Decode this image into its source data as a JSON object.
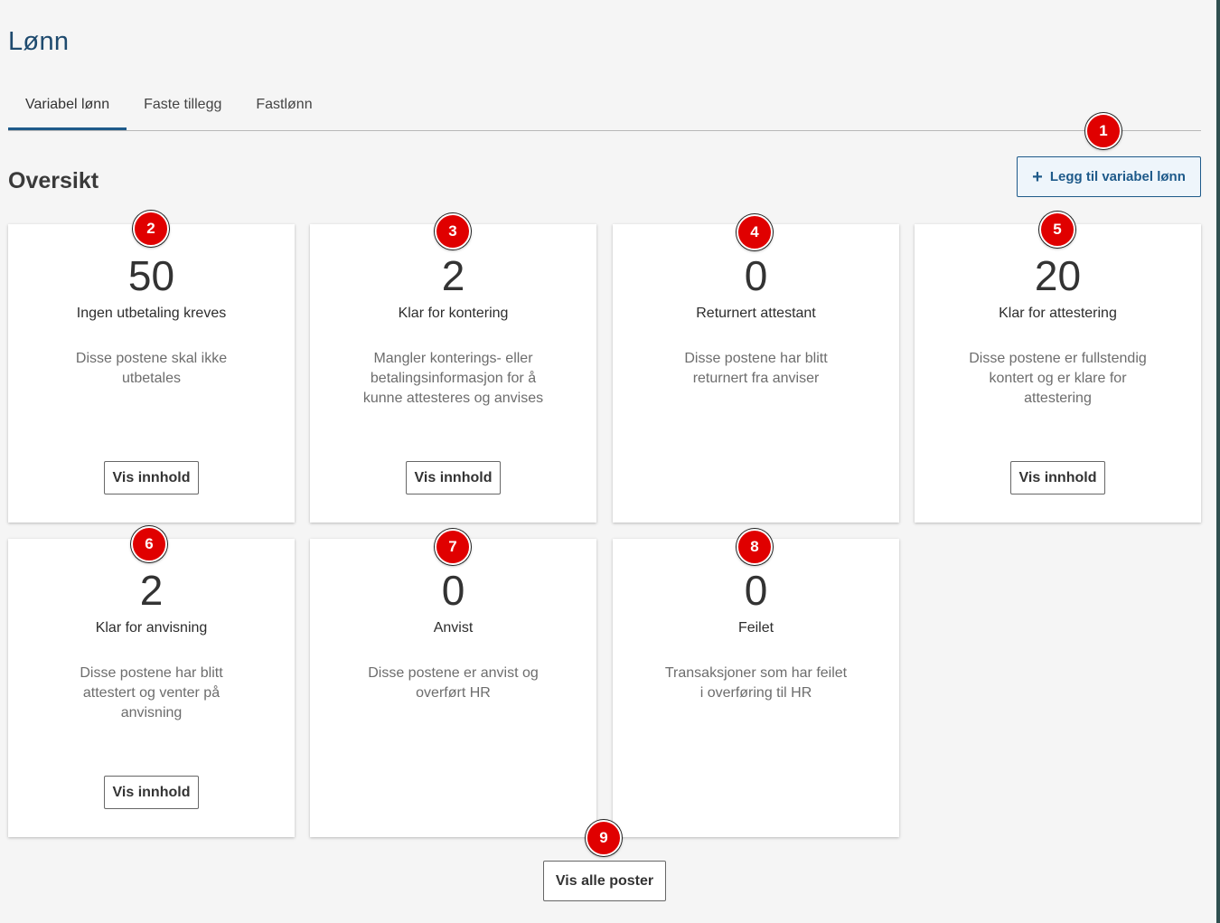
{
  "page": {
    "title": "Lønn"
  },
  "tabs": [
    {
      "label": "Variabel lønn",
      "active": true
    },
    {
      "label": "Faste tillegg",
      "active": false
    },
    {
      "label": "Fastlønn",
      "active": false
    }
  ],
  "overview": {
    "title": "Oversikt",
    "add_button_label": "Legg til variabel lønn",
    "add_button_icon": "plus-icon"
  },
  "cards": [
    {
      "count": "50",
      "label": "Ingen utbetaling kreves",
      "description": "Disse postene skal ikke utbetales",
      "button": "Vis innhold"
    },
    {
      "count": "2",
      "label": "Klar for kontering",
      "description": "Mangler konterings- eller betalingsinformasjon for å kunne attesteres og anvises",
      "button": "Vis innhold"
    },
    {
      "count": "0",
      "label": "Returnert attestant",
      "description": "Disse postene har blitt returnert fra anviser"
    },
    {
      "count": "20",
      "label": "Klar for attestering",
      "description": "Disse postene er fullstendig kontert og er klare for attestering",
      "button": "Vis innhold"
    },
    {
      "count": "2",
      "label": "Klar for anvisning",
      "description": "Disse postene har blitt attestert og venter på anvisning",
      "button": "Vis innhold"
    },
    {
      "count": "0",
      "label": "Anvist",
      "description": "Disse postene er anvist og overført HR"
    },
    {
      "count": "0",
      "label": "Feilet",
      "description": "Transaksjoner som har feilet i overføring til HR"
    }
  ],
  "show_all_label": "Vis alle poster",
  "markers": [
    "1",
    "2",
    "3",
    "4",
    "5",
    "6",
    "7",
    "8",
    "9"
  ],
  "colors": {
    "accent": "#1e5a8a",
    "marker": "#e00000"
  }
}
